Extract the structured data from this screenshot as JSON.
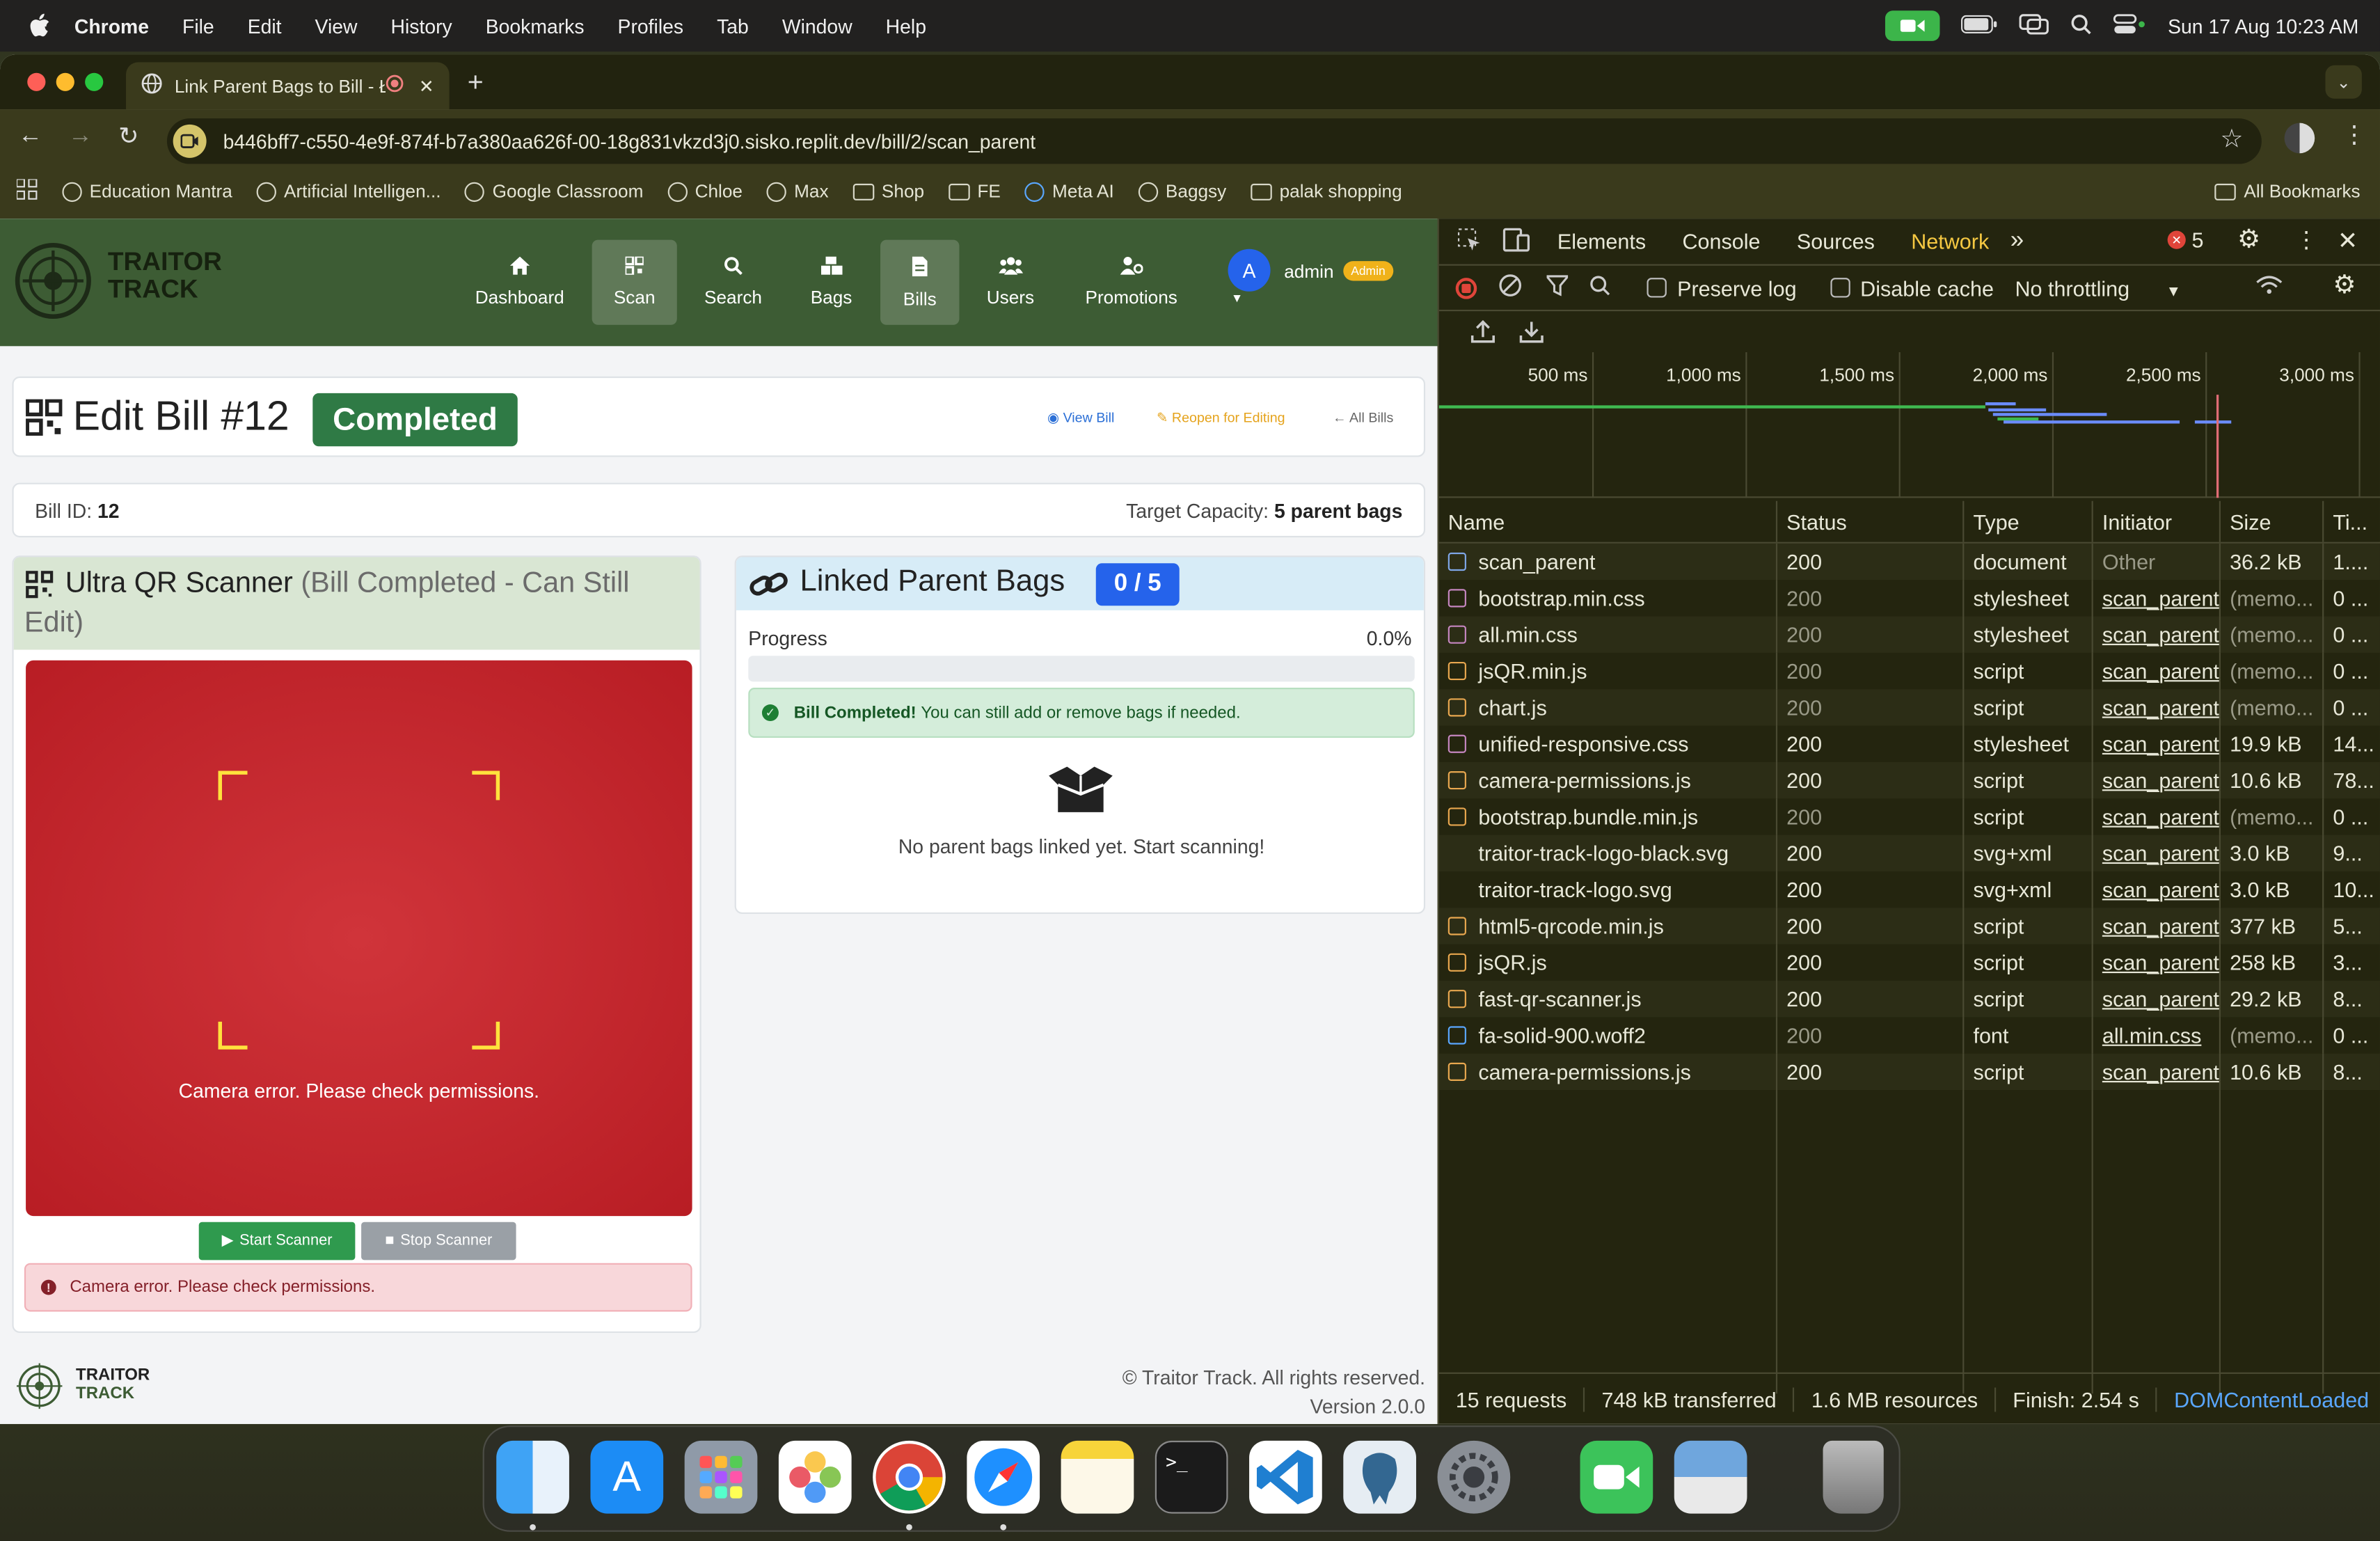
{
  "menubar": {
    "app": "Chrome",
    "items": [
      "File",
      "Edit",
      "View",
      "History",
      "Bookmarks",
      "Profiles",
      "Tab",
      "Window",
      "Help"
    ],
    "datetime": "Sun 17 Aug  10:23 AM"
  },
  "browser": {
    "tab_title": "Link Parent Bags to Bill - Ł",
    "url": "b446bff7-c550-4e9f-874f-b7a380aa626f-00-18g831vkzd3j0.sisko.replit.dev/bill/2/scan_parent",
    "bookmarks": [
      "Education Mantra",
      "Artificial Intelligen...",
      "Google Classroom",
      "Chloe",
      "Max",
      "Shop",
      "FE",
      "Meta AI",
      "Baggsy",
      "palak shopping"
    ],
    "all_bookmarks": "All Bookmarks"
  },
  "app": {
    "logo_line1": "TRAITOR",
    "logo_line2": "TRACK",
    "nav": [
      {
        "label": "Dashboard",
        "icon": "home-icon"
      },
      {
        "label": "Scan",
        "icon": "qrcode-icon"
      },
      {
        "label": "Search",
        "icon": "search-icon"
      },
      {
        "label": "Bags",
        "icon": "boxes-icon"
      },
      {
        "label": "Bills",
        "icon": "file-icon"
      },
      {
        "label": "Users",
        "icon": "users-icon"
      },
      {
        "label": "Promotions",
        "icon": "user-cog-icon"
      }
    ],
    "user": {
      "initial": "A",
      "name": "admin",
      "role": "Admin"
    },
    "header": {
      "title": "Edit Bill #12",
      "status": "Completed",
      "view_bill": "View Bill",
      "reopen": "Reopen for Editing",
      "all_bills": "All Bills"
    },
    "info": {
      "bill_id_label": "Bill ID:",
      "bill_id": "12",
      "capacity_label": "Target Capacity:",
      "capacity": "5 parent bags"
    },
    "scanner": {
      "title": "Ultra QR Scanner",
      "subtitle": "(Bill Completed - Can Still Edit)",
      "error_overlay": "Camera error. Please check permissions.",
      "start": "Start Scanner",
      "stop": "Stop Scanner",
      "error_alert": "Camera error. Please check permissions."
    },
    "linked": {
      "title": "Linked Parent Bags",
      "count": "0 / 5",
      "progress_label": "Progress",
      "progress_value": "0.0%",
      "progress_fraction": 0,
      "alert_bold": "Bill Completed!",
      "alert_text": "You can still add or remove bags if needed.",
      "empty": "No parent bags linked yet. Start scanning!"
    },
    "footer": {
      "logo_line1": "TRAITOR",
      "logo_line2": "TRACK",
      "copyright": "© Traitor Track. All rights reserved.",
      "version": "Version 2.0.0"
    }
  },
  "devtools": {
    "tabs": [
      "Elements",
      "Console",
      "Sources",
      "Network"
    ],
    "active_tab": "Network",
    "error_count": "5",
    "preserve_log": "Preserve log",
    "disable_cache": "Disable cache",
    "throttling": "No throttling",
    "timeline_ticks": [
      "500 ms",
      "1,000 ms",
      "1,500 ms",
      "2,000 ms",
      "2,500 ms",
      "3,000 ms"
    ],
    "columns": [
      "Name",
      "Status",
      "Type",
      "Initiator",
      "Size",
      "Ti..."
    ],
    "rows": [
      {
        "name": "scan_parent",
        "status": "200",
        "type": "document",
        "initiator": "Other",
        "size": "36.2 kB",
        "time": "1....",
        "kind": "doc",
        "dim": false
      },
      {
        "name": "bootstrap.min.css",
        "status": "200",
        "type": "stylesheet",
        "initiator": "scan_parent",
        "size": "(memo...",
        "time": "0 ...",
        "kind": "css",
        "dim": true
      },
      {
        "name": "all.min.css",
        "status": "200",
        "type": "stylesheet",
        "initiator": "scan_parent",
        "size": "(memo...",
        "time": "0 ...",
        "kind": "css",
        "dim": true
      },
      {
        "name": "jsQR.min.js",
        "status": "200",
        "type": "script",
        "initiator": "scan_parent",
        "size": "(memo...",
        "time": "0 ...",
        "kind": "js",
        "dim": true
      },
      {
        "name": "chart.js",
        "status": "200",
        "type": "script",
        "initiator": "scan_parent",
        "size": "(memo...",
        "time": "0 ...",
        "kind": "js",
        "dim": true
      },
      {
        "name": "unified-responsive.css",
        "status": "200",
        "type": "stylesheet",
        "initiator": "scan_parent",
        "size": "19.9 kB",
        "time": "14...",
        "kind": "css",
        "dim": false
      },
      {
        "name": "camera-permissions.js",
        "status": "200",
        "type": "script",
        "initiator": "scan_parent",
        "size": "10.6 kB",
        "time": "78...",
        "kind": "js",
        "dim": false
      },
      {
        "name": "bootstrap.bundle.min.js",
        "status": "200",
        "type": "script",
        "initiator": "scan_parent",
        "size": "(memo...",
        "time": "0 ...",
        "kind": "js",
        "dim": true
      },
      {
        "name": "traitor-track-logo-black.svg",
        "status": "200",
        "type": "svg+xml",
        "initiator": "scan_parent",
        "size": "3.0 kB",
        "time": "9...",
        "kind": "img",
        "dim": false
      },
      {
        "name": "traitor-track-logo.svg",
        "status": "200",
        "type": "svg+xml",
        "initiator": "scan_parent",
        "size": "3.0 kB",
        "time": "10...",
        "kind": "img",
        "dim": false
      },
      {
        "name": "html5-qrcode.min.js",
        "status": "200",
        "type": "script",
        "initiator": "scan_parent",
        "size": "377 kB",
        "time": "5...",
        "kind": "js",
        "dim": false
      },
      {
        "name": "jsQR.js",
        "status": "200",
        "type": "script",
        "initiator": "scan_parent",
        "size": "258 kB",
        "time": "3...",
        "kind": "js",
        "dim": false
      },
      {
        "name": "fast-qr-scanner.js",
        "status": "200",
        "type": "script",
        "initiator": "scan_parent",
        "size": "29.2 kB",
        "time": "8...",
        "kind": "js",
        "dim": false
      },
      {
        "name": "fa-solid-900.woff2",
        "status": "200",
        "type": "font",
        "initiator": "all.min.css",
        "size": "(memo...",
        "time": "0 ...",
        "kind": "font",
        "dim": true
      },
      {
        "name": "camera-permissions.js",
        "status": "200",
        "type": "script",
        "initiator": "scan_parent",
        "size": "10.6 kB",
        "time": "8...",
        "kind": "js",
        "dim": false
      }
    ],
    "status_bar": [
      "15 requests",
      "748 kB transferred",
      "1.6 MB resources",
      "Finish: 2.54 s",
      "DOMContentLoaded"
    ]
  },
  "dock": [
    "Finder",
    "App Store",
    "Launchpad",
    "Photos",
    "Chrome",
    "Safari",
    "Notes",
    "Terminal",
    "VS Code",
    "pgAdmin",
    "System Settings",
    "FaceTime",
    "Preview",
    "Trash"
  ],
  "colors": {
    "nav_green": "#3d5c34",
    "scanner_red": "#c62828",
    "accent_blue": "#2563eb",
    "devtools_bg": "#24250f",
    "network_active": "#f5c842"
  }
}
